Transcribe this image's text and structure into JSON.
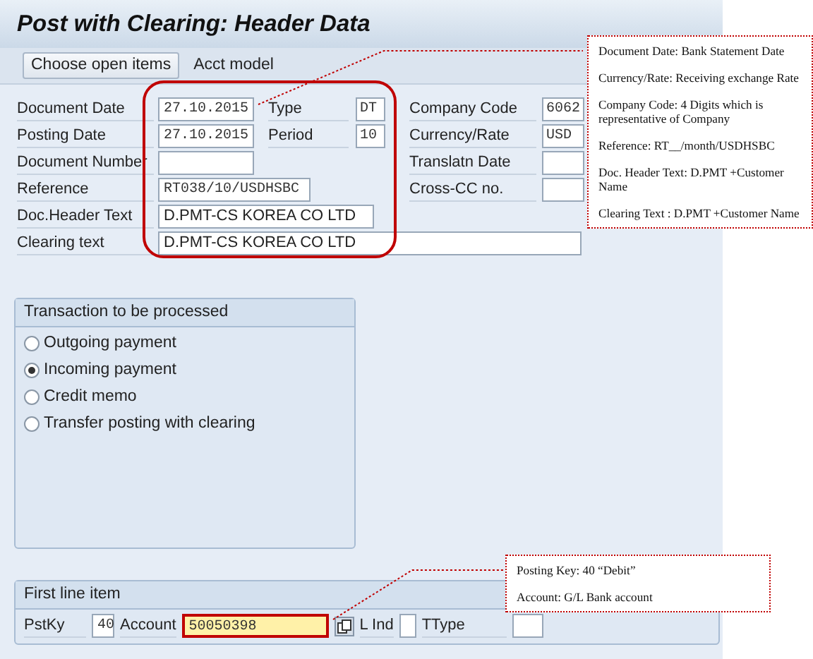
{
  "title": "Post with Clearing: Header Data",
  "toolbar": [
    {
      "label": "Choose open items",
      "kind": "button"
    },
    {
      "label": "Acct model",
      "kind": "link"
    }
  ],
  "header_rows": [
    {
      "left": {
        "label": "Document Date",
        "value": "27.10.2015",
        "kind": "date"
      },
      "middle": {
        "label": "Type",
        "value": "DT"
      },
      "right": {
        "label": "Company Code",
        "value": "6062"
      }
    },
    {
      "left": {
        "label": "Posting Date",
        "value": "27.10.2015",
        "kind": "date"
      },
      "middle": {
        "label": "Period",
        "value": "10"
      },
      "right": {
        "label": "Currency/Rate",
        "value": "USD"
      }
    },
    {
      "left": {
        "label": "Document Number",
        "kind": "date"
      },
      "right": {
        "label": "Translatn Date"
      }
    },
    {
      "left": {
        "label": "Reference",
        "value": "RT038/10/USDHSBC",
        "kind": "reference"
      },
      "right": {
        "label": "Cross-CC no."
      }
    },
    {
      "left": {
        "label": "Doc.Header Text",
        "value": "D.PMT-CS KOREA CO LTD",
        "kind": "text"
      }
    },
    {
      "left": {
        "label": "Clearing text",
        "value": "D.PMT-CS KOREA CO LTD",
        "kind": "wide"
      }
    }
  ],
  "transaction_group": {
    "title": "Transaction to be processed",
    "options": [
      {
        "label": "Outgoing payment",
        "selected": false
      },
      {
        "label": "Incoming payment",
        "selected": true
      },
      {
        "label": "Credit memo",
        "selected": false
      },
      {
        "label": "Transfer posting with clearing",
        "selected": false
      }
    ]
  },
  "first_line_item": {
    "title": "First line item",
    "fields": [
      {
        "label": "PstKy",
        "value": "40",
        "kind": "key",
        "focused": false
      },
      {
        "label": "Account",
        "value": "50050398",
        "kind": "account",
        "focused": true
      },
      {
        "label": "L Ind",
        "kind": "flag",
        "focused": false
      },
      {
        "label": "TType",
        "kind": "type",
        "focused": false
      }
    ]
  },
  "annotations": [
    {
      "lines": [
        "Document Date: Bank Statement Date",
        "Currency/Rate: Receiving exchange Rate",
        "Company Code: 4 Digits which is representative of Company",
        "Reference: RT__/month/USDHSBC",
        "Doc. Header Text: D.PMT +Customer Name",
        "Clearing Text : D.PMT +Customer Name"
      ]
    },
    {
      "lines": [
        "Posting Key: 40 “Debit”",
        "Account: G/L Bank account"
      ]
    }
  ]
}
